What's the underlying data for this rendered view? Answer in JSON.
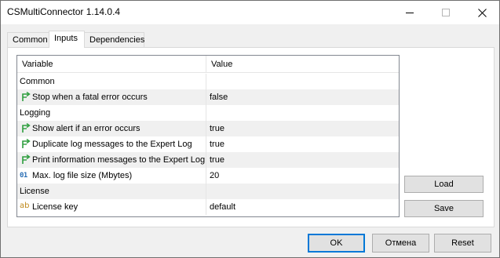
{
  "window": {
    "title": "CSMultiConnector 1.14.0.4"
  },
  "tabs": [
    {
      "label": "Common",
      "active": false
    },
    {
      "label": "Inputs",
      "active": true
    },
    {
      "label": "Dependencies",
      "active": false
    }
  ],
  "grid": {
    "columns": {
      "variable": "Variable",
      "value": "Value"
    },
    "rows": [
      {
        "type": "group",
        "name": "Common",
        "value": ""
      },
      {
        "type": "item",
        "icon": "bool-arrow-icon",
        "name": "Stop when a fatal error occurs",
        "value": "false"
      },
      {
        "type": "group",
        "name": "Logging",
        "value": ""
      },
      {
        "type": "item",
        "icon": "bool-arrow-icon",
        "name": "Show alert if an error occurs",
        "value": "true"
      },
      {
        "type": "item",
        "icon": "bool-arrow-icon",
        "name": "Duplicate log messages to the Expert Log",
        "value": "true"
      },
      {
        "type": "item",
        "icon": "bool-arrow-icon",
        "name": "Print information messages to the Expert Log",
        "value": "true"
      },
      {
        "type": "item",
        "icon": "integer-icon",
        "icon_text": "01",
        "name": "Max. log file size (Mbytes)",
        "value": "20"
      },
      {
        "type": "group",
        "name": "License",
        "value": ""
      },
      {
        "type": "item",
        "icon": "string-icon",
        "icon_text": "ab",
        "name": "License key",
        "value": "default"
      }
    ]
  },
  "side_buttons": {
    "load": "Load",
    "save": "Save"
  },
  "buttons": {
    "ok": "OK",
    "cancel": "Отмена",
    "reset": "Reset"
  },
  "colors": {
    "accent": "#0078d7",
    "bool_icon": "#2e9e3e",
    "alt_row": "#f0f0f0"
  }
}
